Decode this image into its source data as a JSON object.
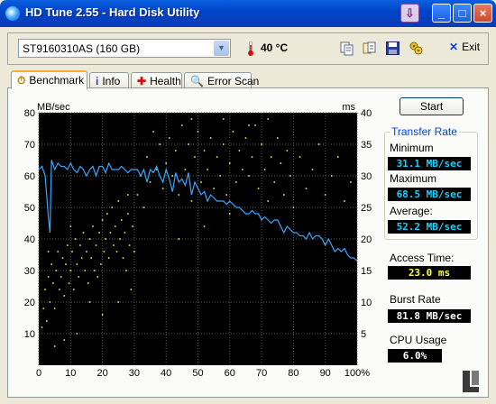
{
  "window": {
    "title": "HD Tune 2.55 - Hard Disk Utility",
    "buttons": {
      "download": "⇩",
      "minimize": "_",
      "maximize": "□",
      "close": "×"
    }
  },
  "toolbar": {
    "drive": "ST9160310AS (160 GB)",
    "temperature": "40 °C",
    "exit_label": "Exit",
    "icons": [
      "copy-icon",
      "copy-all-icon",
      "save-icon",
      "options-icon"
    ]
  },
  "tabs": [
    {
      "label": "Benchmark",
      "icon": "stopwatch-icon"
    },
    {
      "label": "Info",
      "icon": "info-icon"
    },
    {
      "label": "Health",
      "icon": "health-icon"
    },
    {
      "label": "Error Scan",
      "icon": "scan-icon"
    }
  ],
  "side": {
    "start_label": "Start",
    "transfer_rate_title": "Transfer Rate",
    "minimum_label": "Minimum",
    "minimum_value": "31.1 MB/sec",
    "maximum_label": "Maximum",
    "maximum_value": "68.5 MB/sec",
    "average_label": "Average:",
    "average_value": "52.2 MB/sec",
    "access_label": "Access Time:",
    "access_value": "23.0 ms",
    "burst_label": "Burst Rate",
    "burst_value": "81.8 MB/sec",
    "cpu_label": "CPU Usage",
    "cpu_value": "6.0%"
  },
  "colors": {
    "transfer_line": "#35a9ff",
    "access_dots": "#e8e860",
    "plot_bg": "#000000",
    "grid": "#5a5a5a"
  },
  "chart_data": {
    "type": "line",
    "ylabel": "MB/sec",
    "y2label": "ms",
    "ylim": [
      0,
      80
    ],
    "y2lim": [
      0,
      40
    ],
    "xlim": [
      0,
      100
    ],
    "x_ticks": [
      "0",
      "10",
      "20",
      "30",
      "40",
      "50",
      "60",
      "70",
      "80",
      "90",
      "100%"
    ],
    "y_ticks": [
      "10",
      "20",
      "30",
      "40",
      "50",
      "60",
      "70",
      "80"
    ],
    "y2_ticks": [
      "5",
      "10",
      "15",
      "20",
      "25",
      "30",
      "35",
      "40"
    ],
    "grid": true,
    "series": [
      {
        "axis": "left",
        "x": [
          0,
          1,
          2,
          3,
          3.5,
          4,
          5,
          6,
          7,
          8,
          9,
          10,
          11,
          12,
          13,
          14,
          15,
          16,
          17,
          18,
          19,
          20,
          21,
          22,
          23,
          24,
          25,
          26,
          27,
          28,
          29,
          30,
          31,
          32,
          33,
          34,
          35,
          36,
          37,
          38,
          39,
          40,
          41,
          42,
          43,
          44,
          45,
          46,
          47,
          48,
          49,
          50,
          51,
          52,
          53,
          54,
          55,
          56,
          57,
          58,
          59,
          60,
          61,
          62,
          63,
          64,
          65,
          66,
          67,
          68,
          69,
          70,
          71,
          72,
          73,
          74,
          75,
          76,
          77,
          78,
          79,
          80,
          81,
          82,
          83,
          84,
          85,
          86,
          87,
          88,
          89,
          90,
          91,
          92,
          93,
          94,
          95,
          96,
          97,
          98,
          99,
          100
        ],
        "values": [
          62,
          63,
          60,
          47,
          42,
          65,
          62,
          64,
          63,
          63,
          62,
          64,
          62,
          61,
          63,
          62,
          60,
          62,
          63,
          60,
          63,
          63,
          61,
          64,
          62,
          62,
          62,
          63,
          62,
          61,
          62,
          62,
          62,
          60,
          62,
          58,
          62,
          61,
          63,
          60,
          58,
          62,
          59,
          55,
          61,
          58,
          59,
          57,
          61,
          54,
          58,
          56,
          54,
          55,
          52,
          54,
          53,
          52,
          52,
          52,
          51,
          52,
          51,
          50,
          50,
          49,
          48,
          48,
          49,
          48,
          48,
          46,
          47,
          46,
          45,
          46,
          46,
          44,
          42,
          44,
          43,
          42,
          42,
          41,
          41,
          40,
          42,
          40,
          41,
          41,
          40,
          38,
          40,
          38,
          36,
          37,
          36,
          37,
          35,
          34,
          34,
          33
        ]
      },
      {
        "type": "scatter",
        "axis": "right",
        "points": [
          [
            1,
            6
          ],
          [
            1.5,
            9
          ],
          [
            2,
            12
          ],
          [
            2.5,
            7
          ],
          [
            3,
            14
          ],
          [
            3.5,
            10
          ],
          [
            4,
            16
          ],
          [
            4.5,
            13
          ],
          [
            5,
            9
          ],
          [
            5.5,
            15
          ],
          [
            6,
            18
          ],
          [
            6.5,
            12
          ],
          [
            7,
            14
          ],
          [
            7.5,
            17
          ],
          [
            8,
            11
          ],
          [
            8.5,
            16
          ],
          [
            9,
            19
          ],
          [
            9.5,
            13
          ],
          [
            10,
            15
          ],
          [
            10.5,
            18
          ],
          [
            11,
            12
          ],
          [
            11.5,
            20
          ],
          [
            12,
            16
          ],
          [
            12.5,
            14
          ],
          [
            13,
            19
          ],
          [
            13.5,
            17
          ],
          [
            14,
            21
          ],
          [
            14.5,
            15
          ],
          [
            15,
            18
          ],
          [
            15.5,
            13
          ],
          [
            16,
            20
          ],
          [
            16.5,
            17
          ],
          [
            17,
            22
          ],
          [
            17.5,
            15
          ],
          [
            18,
            19
          ],
          [
            18.5,
            14
          ],
          [
            19,
            21
          ],
          [
            19.5,
            16
          ],
          [
            20,
            23
          ],
          [
            20.5,
            18
          ],
          [
            21,
            20
          ],
          [
            21.5,
            24
          ],
          [
            22,
            17
          ],
          [
            22.5,
            21
          ],
          [
            23,
            25
          ],
          [
            23.5,
            19
          ],
          [
            24,
            22
          ],
          [
            24.5,
            18
          ],
          [
            25,
            26
          ],
          [
            25.5,
            20
          ],
          [
            26,
            23
          ],
          [
            26.5,
            17
          ],
          [
            27,
            21
          ],
          [
            27.5,
            15
          ],
          [
            28,
            24
          ],
          [
            28.5,
            19
          ],
          [
            29,
            12
          ],
          [
            29.5,
            22
          ],
          [
            30,
            18
          ],
          [
            31,
            27
          ],
          [
            32,
            30
          ],
          [
            33,
            25
          ],
          [
            34,
            33
          ],
          [
            35,
            29
          ],
          [
            36,
            37
          ],
          [
            37,
            31
          ],
          [
            38,
            35
          ],
          [
            39,
            28
          ],
          [
            40,
            32
          ],
          [
            41,
            36
          ],
          [
            42,
            30
          ],
          [
            43,
            34
          ],
          [
            44,
            27
          ],
          [
            45,
            38
          ],
          [
            46,
            31
          ],
          [
            47,
            35
          ],
          [
            48,
            26
          ],
          [
            49,
            33
          ],
          [
            50,
            37
          ],
          [
            51,
            29
          ],
          [
            52,
            34
          ],
          [
            53,
            31
          ],
          [
            54,
            36
          ],
          [
            55,
            28
          ],
          [
            56,
            33
          ],
          [
            57,
            30
          ],
          [
            58,
            35
          ],
          [
            59,
            27
          ],
          [
            60,
            32
          ],
          [
            61,
            37
          ],
          [
            62,
            29
          ],
          [
            63,
            34
          ],
          [
            64,
            31
          ],
          [
            65,
            36
          ],
          [
            66,
            30
          ],
          [
            67,
            33
          ],
          [
            68,
            38
          ],
          [
            69,
            28
          ],
          [
            70,
            35
          ],
          [
            71,
            31
          ],
          [
            72,
            26
          ],
          [
            73,
            33
          ],
          [
            74,
            29
          ],
          [
            75,
            36
          ],
          [
            76,
            32
          ],
          [
            77,
            27
          ],
          [
            78,
            34
          ],
          [
            79,
            30
          ],
          [
            80,
            25
          ],
          [
            82,
            33
          ],
          [
            84,
            28
          ],
          [
            86,
            31
          ],
          [
            88,
            35
          ],
          [
            90,
            27
          ],
          [
            92,
            30
          ],
          [
            94,
            33
          ],
          [
            96,
            26
          ],
          [
            98,
            29
          ],
          [
            12,
            5
          ],
          [
            8,
            4
          ],
          [
            5,
            3
          ],
          [
            20,
            8
          ],
          [
            16,
            10
          ],
          [
            3,
            18
          ],
          [
            10,
            22
          ],
          [
            25,
            10
          ],
          [
            28,
            27
          ],
          [
            44,
            20
          ],
          [
            52,
            22
          ],
          [
            60,
            24
          ],
          [
            66,
            38
          ],
          [
            72,
            39
          ],
          [
            58,
            39
          ],
          [
            48,
            39
          ]
        ]
      }
    ]
  }
}
